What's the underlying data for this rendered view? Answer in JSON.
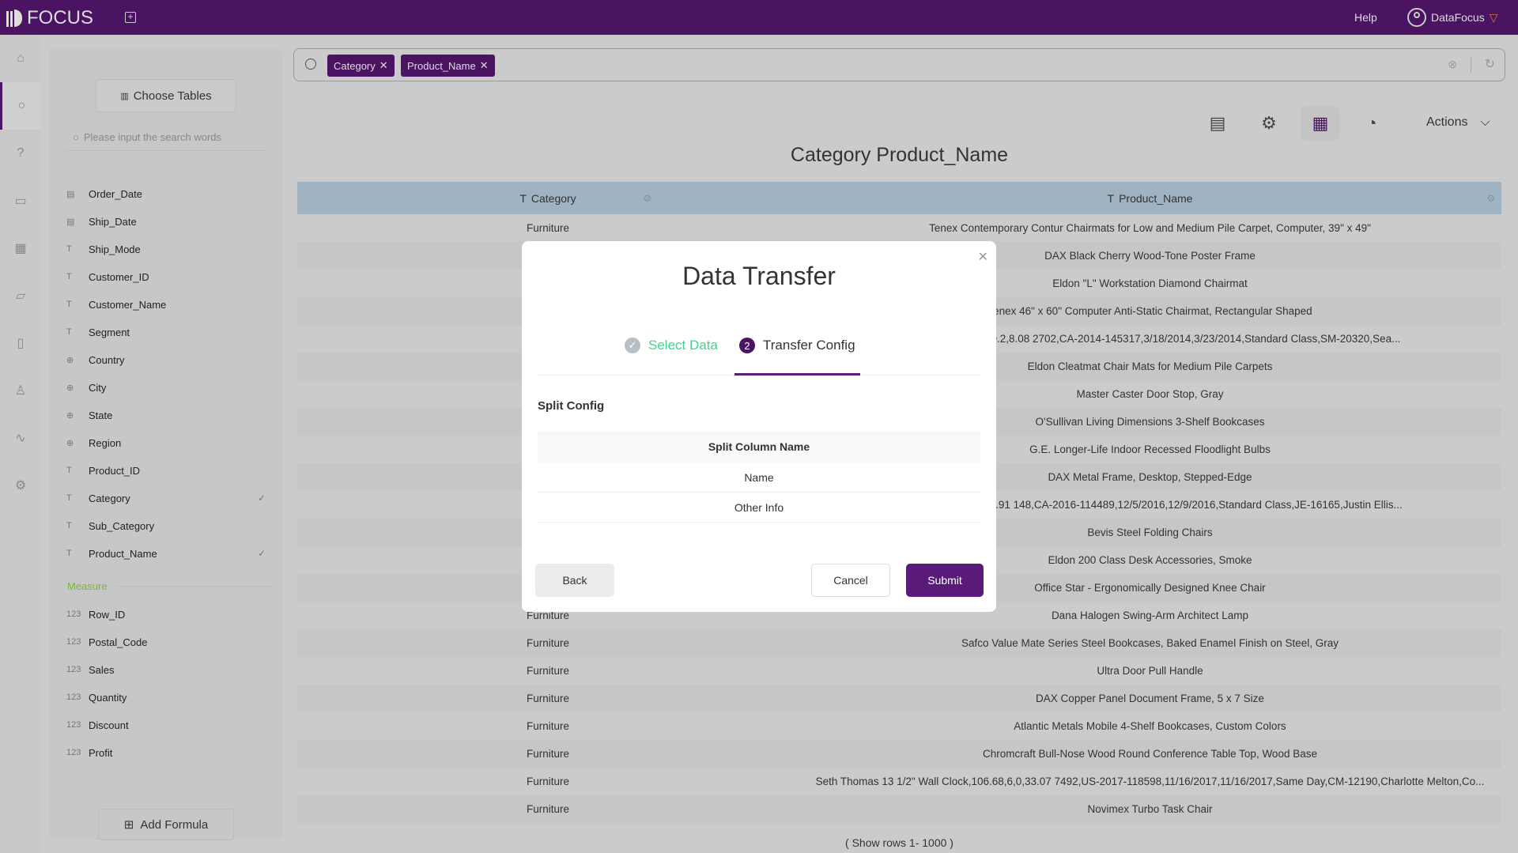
{
  "header": {
    "logo": "FOCUS",
    "help": "Help",
    "user": "DataFocus"
  },
  "rail": {
    "items": [
      "home",
      "search",
      "help",
      "monitor",
      "table",
      "folder",
      "clipboard",
      "user",
      "activity",
      "settings"
    ],
    "active": "search"
  },
  "panel": {
    "choose_tables": "Choose Tables",
    "search_placeholder": "Please input the search words",
    "fields": [
      {
        "name": "Order_Date",
        "type": "date",
        "checked": false
      },
      {
        "name": "Ship_Date",
        "type": "date",
        "checked": false
      },
      {
        "name": "Ship_Mode",
        "type": "text",
        "checked": false
      },
      {
        "name": "Customer_ID",
        "type": "text",
        "checked": false
      },
      {
        "name": "Customer_Name",
        "type": "text",
        "checked": false
      },
      {
        "name": "Segment",
        "type": "text",
        "checked": false
      },
      {
        "name": "Country",
        "type": "geo",
        "checked": false
      },
      {
        "name": "City",
        "type": "geo",
        "checked": false
      },
      {
        "name": "State",
        "type": "geo",
        "checked": false
      },
      {
        "name": "Region",
        "type": "geo",
        "checked": false
      },
      {
        "name": "Product_ID",
        "type": "text",
        "checked": false
      },
      {
        "name": "Category",
        "type": "text",
        "checked": true
      },
      {
        "name": "Sub_Category",
        "type": "text",
        "checked": false
      },
      {
        "name": "Product_Name",
        "type": "text",
        "checked": true
      }
    ],
    "measure_label": "Measure",
    "measures": [
      "Row_ID",
      "Postal_Code",
      "Sales",
      "Quantity",
      "Discount",
      "Profit"
    ],
    "add_formula": "Add Formula"
  },
  "search": {
    "chips": [
      "Category",
      "Product_Name"
    ]
  },
  "toolbar": {
    "actions": "Actions",
    "active": "table"
  },
  "result": {
    "title": "Category Product_Name",
    "columns": [
      "Category",
      "Product_Name"
    ],
    "rows": [
      [
        "Furniture",
        "Tenex Contemporary Contur Chairmats for Low and Medium Pile Carpet, Computer, 39\" x 49\""
      ],
      [
        "Furniture",
        "DAX Black Cherry Wood-Tone Poster Frame"
      ],
      [
        "Furniture",
        "Eldon \"L\" Workstation Diamond Chairmat"
      ],
      [
        "Furniture",
        "Tenex 46\" x 60\" Computer Anti-Static Chairmat, Rectangular Shaped"
      ],
      [
        "Furniture",
        "Wall Clock,30.77,2,0.2,8.08  2702,CA-2014-145317,3/18/2014,3/23/2014,Standard Class,SM-20320,Sea..."
      ],
      [
        "Furniture",
        "Eldon Cleatmat Chair Mats for Medium Pile Carpets"
      ],
      [
        "Furniture",
        "Master Caster Door Stop, Gray"
      ],
      [
        "Furniture",
        "O'Sullivan Living Dimensions 3-Shelf Bookcases"
      ],
      [
        "Furniture",
        "G.E. Longer-Life Indoor Recessed Floodlight Bulbs"
      ],
      [
        "Furniture",
        "DAX Metal Frame, Desktop, Stepped-Edge"
      ],
      [
        "Furniture",
        "Clock,93.89,4,0.2,12.91  148,CA-2016-114489,12/5/2016,12/9/2016,Standard Class,JE-16165,Justin Ellis..."
      ],
      [
        "Furniture",
        "Bevis Steel Folding Chairs"
      ],
      [
        "Furniture",
        "Eldon 200 Class Desk Accessories, Smoke"
      ],
      [
        "Furniture",
        "Office Star - Ergonomically Designed Knee Chair"
      ],
      [
        "Furniture",
        "Dana Halogen Swing-Arm Architect Lamp"
      ],
      [
        "Furniture",
        "Safco Value Mate Series Steel Bookcases, Baked Enamel Finish on Steel, Gray"
      ],
      [
        "Furniture",
        "Ultra Door Pull Handle"
      ],
      [
        "Furniture",
        "DAX Copper Panel Document Frame, 5 x 7 Size"
      ],
      [
        "Furniture",
        "Atlantic Metals Mobile 4-Shelf Bookcases, Custom Colors"
      ],
      [
        "Furniture",
        "Chromcraft Bull-Nose Wood Round Conference Table Top, Wood Base"
      ],
      [
        "Furniture",
        "Seth Thomas 13 1/2\" Wall Clock,106.68,6,0,33.07  7492,US-2017-118598,11/16/2017,11/16/2017,Same Day,CM-12190,Charlotte Melton,Co..."
      ],
      [
        "Furniture",
        "Novimex Turbo Task Chair"
      ]
    ],
    "footer": "( Show rows 1- 1000 )"
  },
  "modal": {
    "title": "Data Transfer",
    "steps": [
      {
        "num": "1",
        "label": "Select Data",
        "status": "done"
      },
      {
        "num": "2",
        "label": "Transfer Config",
        "status": "active"
      }
    ],
    "section": "Split Config",
    "table_header": "Split Column Name",
    "table_rows": [
      "Name",
      "Other Info"
    ],
    "back": "Back",
    "cancel": "Cancel",
    "submit": "Submit"
  },
  "colors": {
    "brand": "#4a1463",
    "accent_button": "#5a1a7a",
    "done_step": "#3dd68c",
    "measure": "#7fb43c"
  }
}
